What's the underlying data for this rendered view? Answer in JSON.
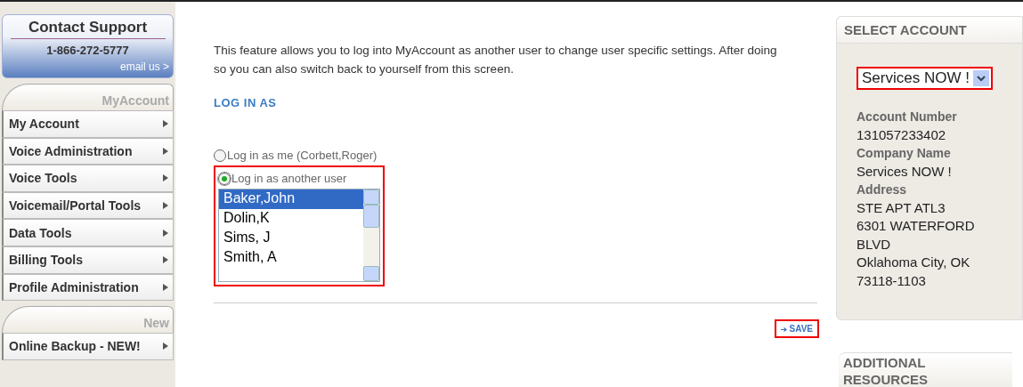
{
  "support": {
    "title": "Contact Support",
    "phone": "1-866-272-5777",
    "email_link": "email us >"
  },
  "nav_sections": [
    {
      "heading": "MyAccount",
      "items": [
        {
          "label": "My Account"
        },
        {
          "label": "Voice Administration"
        },
        {
          "label": "Voice Tools"
        },
        {
          "label": "Voicemail/Portal Tools"
        },
        {
          "label": "Data Tools"
        },
        {
          "label": "Billing Tools"
        },
        {
          "label": "Profile Administration"
        }
      ]
    },
    {
      "heading": "New",
      "items": [
        {
          "label": "Online Backup - NEW!"
        }
      ]
    }
  ],
  "intro": "This feature allows you to log into MyAccount as another user to change user specific settings. After doing so you can also switch back to yourself from this screen.",
  "section_title": "LOG IN AS",
  "options": [
    {
      "label": "Log in as me (Corbett,Roger)",
      "selected": false
    },
    {
      "label": "Log in as another user",
      "selected": true
    }
  ],
  "users": [
    {
      "name": "Baker,John",
      "selected": true
    },
    {
      "name": "Dolin,K",
      "selected": false
    },
    {
      "name": "Sims, J",
      "selected": false
    },
    {
      "name": "Smith, A",
      "selected": false
    }
  ],
  "save_button": "SAVE",
  "select_account": {
    "title": "SELECT ACCOUNT",
    "value": "Services NOW !",
    "fields": [
      {
        "label": "Account Number",
        "lines": [
          "131057233402"
        ]
      },
      {
        "label": "Company Name",
        "lines": [
          "Services NOW !"
        ]
      },
      {
        "label": "Address",
        "lines": [
          "STE APT ATL3",
          "6301 WATERFORD",
          "BLVD",
          "Oklahoma City, OK",
          "73118-1103"
        ]
      }
    ]
  },
  "additional_resources": {
    "title": "ADDITIONAL RESOURCES"
  }
}
